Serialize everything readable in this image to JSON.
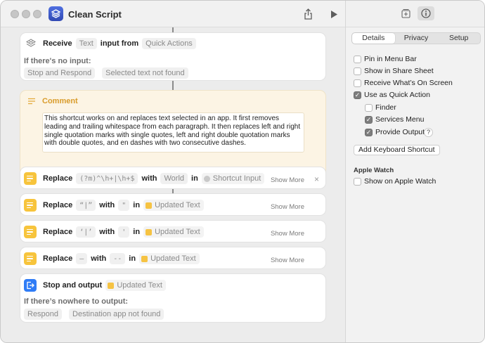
{
  "window": {
    "title": "Clean Script"
  },
  "toolbar": {
    "share_icon": "share-icon",
    "run_icon": "play-icon"
  },
  "inspector": {
    "tabs": [
      "Details",
      "Privacy",
      "Setup"
    ],
    "active_tab": "Details",
    "options": [
      {
        "label": "Pin in Menu Bar",
        "checked": false
      },
      {
        "label": "Show in Share Sheet",
        "checked": false
      },
      {
        "label": "Receive What’s On Screen",
        "checked": false
      },
      {
        "label": "Use as Quick Action",
        "checked": true
      },
      {
        "label": "Finder",
        "checked": false
      },
      {
        "label": "Services Menu",
        "checked": true
      },
      {
        "label": "Provide Output",
        "checked": true
      }
    ],
    "help_label": "?",
    "keyboard_shortcut_button": "Add Keyboard Shortcut",
    "apple_watch_title": "Apple Watch",
    "apple_watch_option": {
      "label": "Show on Apple Watch",
      "checked": false
    }
  },
  "receive": {
    "label": "Receive",
    "type": "Text",
    "middle": "input from",
    "source": "Quick Actions",
    "no_input_label": "If there's no input:",
    "no_input_action": "Stop and Respond",
    "no_input_message": "Selected text not found"
  },
  "comment": {
    "label": "Comment",
    "text": "This shortcut works on and replaces text selected in an app. It first removes leading and trailing whitespace from each paragraph. It then replaces left and right single quotation marks with single quotes, left and right double quotation marks with double quotes, and en dashes with two consecutive dashes."
  },
  "replace_actions": [
    {
      "label": "Replace",
      "find": "(?m)^\\h+|\\h+$",
      "with_label": "with",
      "replacement": "World",
      "in_label": "in",
      "target": "Shortcut Input",
      "show_more": "Show More",
      "close": "×"
    },
    {
      "label": "Replace",
      "find": "“|”",
      "with_label": "with",
      "replacement": "\"",
      "in_label": "in",
      "target": "Updated Text",
      "show_more": "Show More"
    },
    {
      "label": "Replace",
      "find": "‘|’",
      "with_label": "with",
      "replacement": "'",
      "in_label": "in",
      "target": "Updated Text",
      "show_more": "Show More"
    },
    {
      "label": "Replace",
      "find": "–",
      "with_label": "with",
      "replacement": "--",
      "in_label": "in",
      "target": "Updated Text",
      "show_more": "Show More"
    }
  ],
  "stop_output": {
    "label": "Stop and output",
    "target": "Updated Text",
    "nowhere_label": "If there’s nowhere to output:",
    "nowhere_action": "Respond",
    "nowhere_message": "Destination app not found"
  }
}
